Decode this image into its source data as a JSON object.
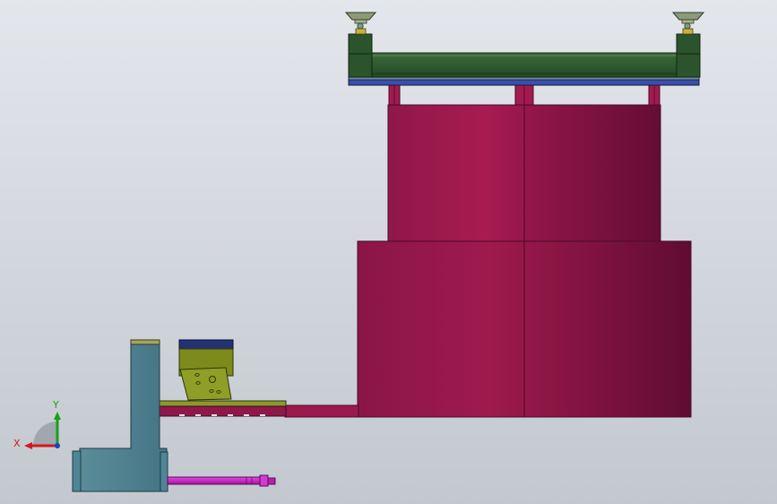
{
  "colors": {
    "background_top": "#e3e6eb",
    "background_bottom": "#c3c8cf",
    "crimson_body": "#9a1a4a",
    "crimson_shade": "#6e0f35",
    "dark_green": "#2e5a2e",
    "olive": "#7c8a1e",
    "steel_teal": "#4c7f8f",
    "navy": "#1f2f6e",
    "magenta_rod": "#c21fbf",
    "axis_x": "#d21a1a",
    "axis_y": "#17a017",
    "axis_z": "#1a3fd2"
  },
  "triad": {
    "x_label": "X",
    "y_label": "Y"
  }
}
